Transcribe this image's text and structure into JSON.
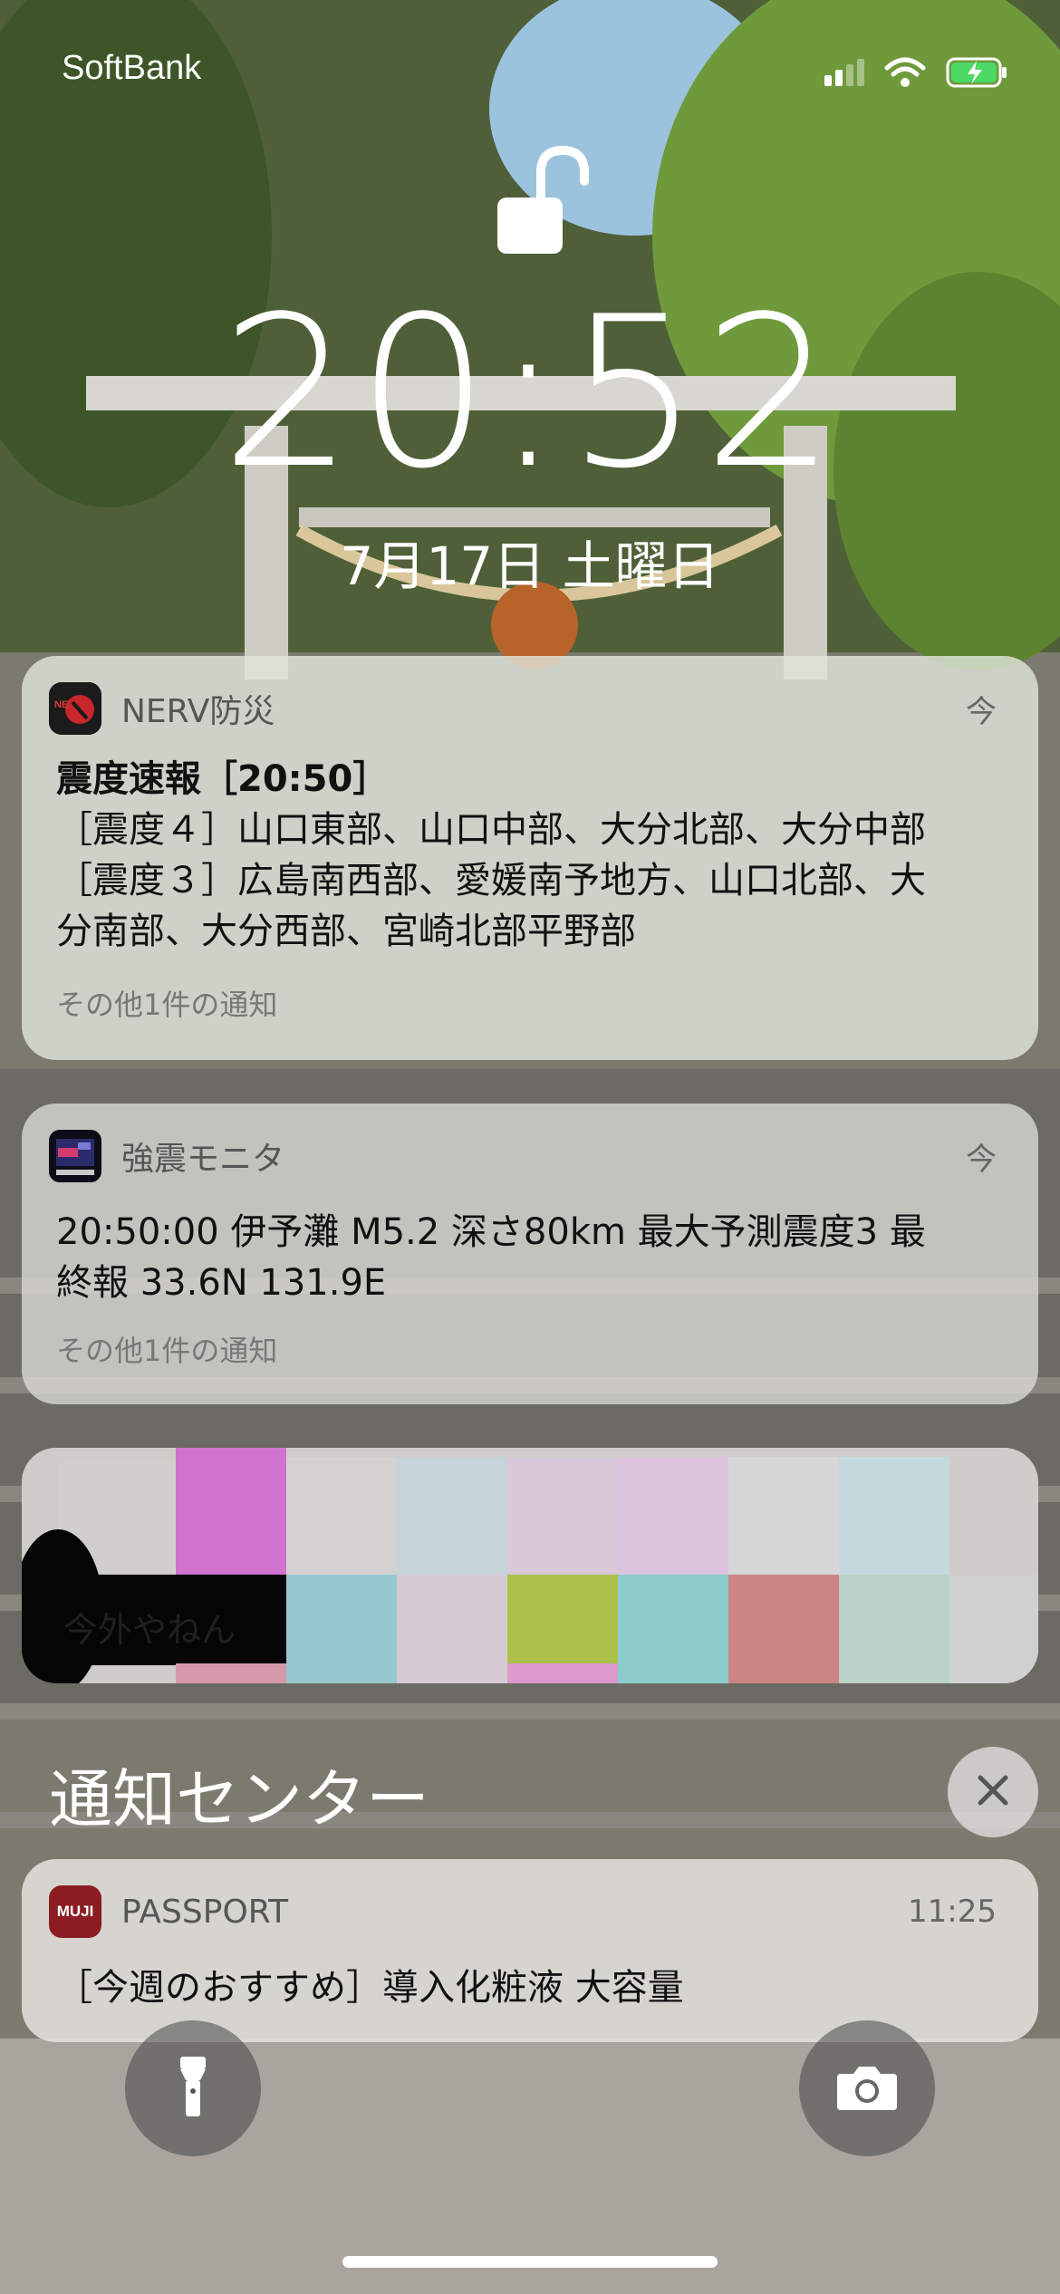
{
  "status_bar": {
    "carrier": "SoftBank",
    "icons": [
      "signal-icon",
      "wifi-icon",
      "battery-charging-icon"
    ]
  },
  "lock_screen": {
    "time": "20:52",
    "date": "7月17日 土曜日"
  },
  "notifications": [
    {
      "app": "NERV防災",
      "time": "今",
      "title": "震度速報［20:50］",
      "lines": [
        "［震度４］山口東部、山口中部、大分北部、大分中部",
        "［震度３］広島南西部、愛媛南予地方、山口北部、大",
        "分南部、大分西部、宮崎北部平野部"
      ],
      "more": "その他1件の通知"
    },
    {
      "app": "強震モニタ",
      "time": "今",
      "lines": [
        "20:50:00 伊予灘 M5.2 深さ80km 最大予測震度3 最",
        "終報 33.6N 131.9E"
      ],
      "more": "その他1件の通知"
    },
    {
      "redacted_text": "今外やねん"
    }
  ],
  "notification_center": {
    "title": "通知センター",
    "items": [
      {
        "app": "PASSPORT",
        "icon_text": "MUJI",
        "time": "11:25",
        "body": "［今週のおすすめ］導入化粧液 大容量"
      }
    ]
  },
  "quick_actions": {
    "left": "flashlight-icon",
    "right": "camera-icon"
  }
}
